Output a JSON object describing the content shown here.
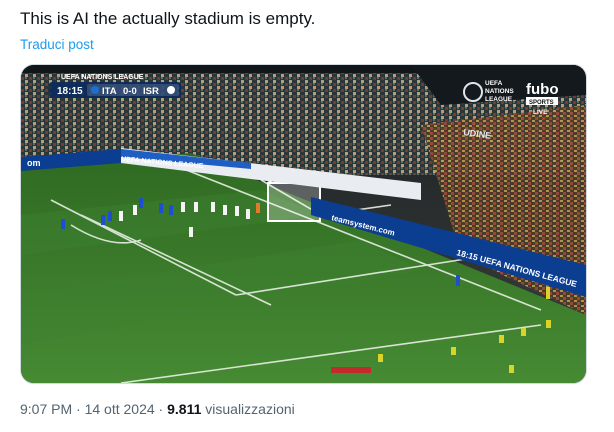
{
  "tweet": {
    "text": "This is AI the actually stadium is empty.",
    "translate_label": "Traduci post"
  },
  "broadcast": {
    "competition": "UEFA NATIONS LEAGUE",
    "clock": "18:15",
    "home": "ITA",
    "score": "0-0",
    "away": "ISR",
    "logo_line1": "UEFA",
    "logo_line2": "NATIONS",
    "logo_line3": "LEAGUE",
    "channel": "fubo",
    "channel_sub": "SPORTS",
    "live": "LIVE",
    "board_text": "18:15 UEFA NATIONS LEAGUE",
    "board_brand": "teamsystem.com",
    "side_board": "UEFA NATIONS LEAGUE",
    "stadium_sign": "UDINE"
  },
  "meta": {
    "time": "9:07 PM",
    "sep1": "·",
    "date": "14 ott 2024",
    "sep2": "·",
    "views": "9.811",
    "views_label": "visualizzazioni"
  },
  "colors": {
    "text": "#0f1419",
    "link": "#1d9bf0",
    "muted": "#536471",
    "pitch": "#3c7a2a",
    "board_blue": "#0b3d91"
  }
}
